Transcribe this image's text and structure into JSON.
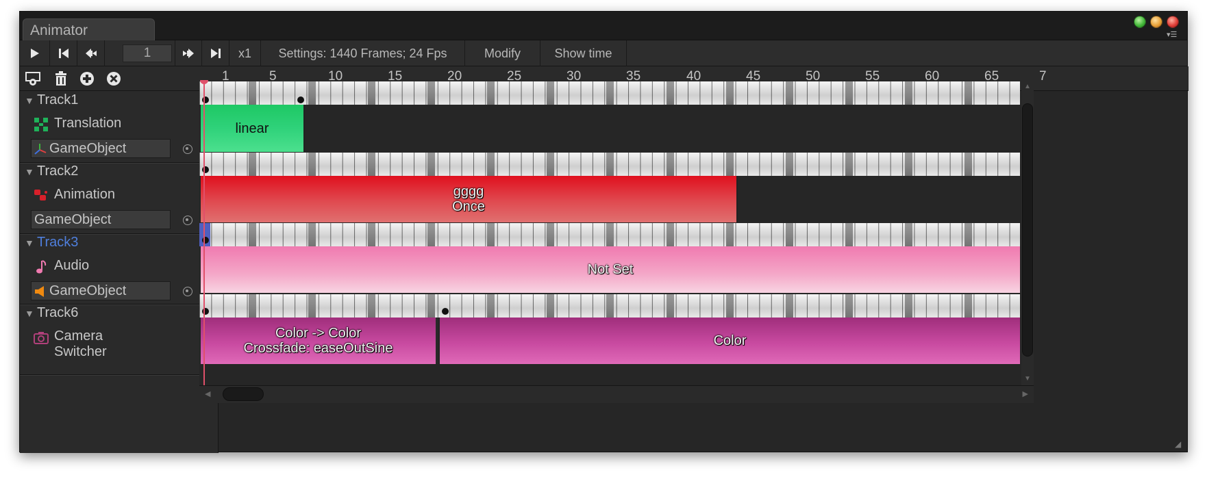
{
  "window": {
    "tab_title": "Animator",
    "traffic_lights": [
      "#44b83a",
      "#e8a23a",
      "#e0403a"
    ],
    "menu_icon": "panel-menu-icon"
  },
  "toolbar": {
    "play_icon": "play-icon",
    "first_frame_icon": "skip-to-start-icon",
    "prev_frame_icon": "previous-frame-icon",
    "frame_value": "1",
    "next_frame_icon": "next-frame-icon",
    "last_frame_icon": "skip-to-end-icon",
    "speed": "x1",
    "settings": "Settings: 1440 Frames; 24 Fps",
    "modify": "Modify",
    "show_time": "Show time"
  },
  "tools": [
    "add-track-icon",
    "trash-icon",
    "add-icon",
    "remove-icon"
  ],
  "ruler": {
    "ticks": [
      "1",
      "5",
      "10",
      "15",
      "20",
      "25",
      "30",
      "35",
      "40",
      "45",
      "50",
      "55",
      "60",
      "65",
      "7"
    ]
  },
  "tracks": [
    {
      "name": "Track1",
      "component": "Translation",
      "component_icon": "translation-icon",
      "object": "GameObject",
      "object_icon": "transform-icon",
      "clips": [
        {
          "label1": "linear",
          "label2": "",
          "color": "#2fd27a"
        }
      ]
    },
    {
      "name": "Track2",
      "component": "Animation",
      "component_icon": "animation-icon",
      "object": "GameObject",
      "object_icon": "",
      "clips": [
        {
          "label1": "gggg",
          "label2": "Once",
          "color": "#e0303a"
        }
      ]
    },
    {
      "name": "Track3",
      "component": "Audio",
      "component_icon": "audio-note-icon",
      "object": "GameObject",
      "object_icon": "audio-source-icon",
      "selected": true,
      "clips": [
        {
          "label1": "Not Set",
          "label2": "",
          "color": "#f08cb8"
        }
      ]
    },
    {
      "name": "Track6",
      "component": "Camera Switcher",
      "component_icon": "camera-icon",
      "object": "",
      "clips": [
        {
          "label1": "Color -> Color",
          "label2": "Crossfade: easeOutSine",
          "color": "#c84aa0"
        },
        {
          "label1": "Color",
          "label2": "",
          "color": "#c84aa0"
        }
      ]
    }
  ],
  "colors": {
    "selected_track": "#4f7fdc",
    "playhead": "#e0506a"
  }
}
